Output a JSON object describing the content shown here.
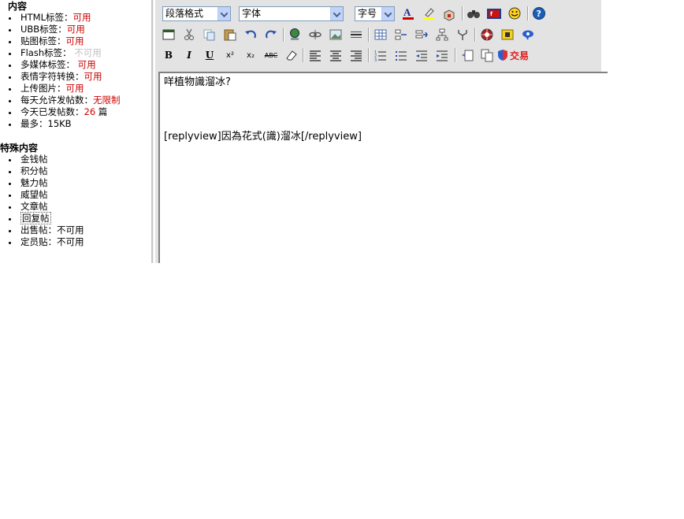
{
  "left": {
    "section1_title": "内容",
    "tags": [
      {
        "label": "HTML标签：",
        "value": "可用",
        "style": "red"
      },
      {
        "label": "UBB标签：",
        "value": "可用",
        "style": "red"
      },
      {
        "label": "贴图标签：",
        "value": "可用",
        "style": "red"
      },
      {
        "label": "Flash标签：",
        "value": "不可用",
        "style": "gray"
      },
      {
        "label": "多媒体标签：",
        "value": "可用",
        "style": "red"
      },
      {
        "label": "表情字符转换：",
        "value": "可用",
        "style": "red"
      },
      {
        "label": "上传图片：",
        "value": "可用",
        "style": "red"
      },
      {
        "label": "每天允许发帖数：",
        "value": "无限制",
        "style": "red"
      },
      {
        "label": "今天已发帖数：",
        "value": "26",
        "suffix": " 篇",
        "style": "red"
      },
      {
        "label": "最多：",
        "value": "15KB",
        "style": "plain"
      }
    ],
    "section2_title": "特殊内容",
    "special": [
      {
        "label": "金钱帖"
      },
      {
        "label": "积分帖"
      },
      {
        "label": "魅力帖"
      },
      {
        "label": "威望帖"
      },
      {
        "label": "文章帖"
      },
      {
        "label": "回复帖"
      },
      {
        "label": "出售帖：不可用"
      },
      {
        "label": "定员贴：不可用"
      }
    ]
  },
  "toolbar": {
    "paragraph_select": "段落格式",
    "font_select": "字体",
    "size_select": "字号",
    "bold_glyph": "B",
    "italic_glyph": "I",
    "underline_glyph": "U",
    "superscript_glyph": "x²",
    "subscript_glyph": "x₂",
    "strike_glyph": "ABC",
    "trade_label": "交易",
    "icons": {
      "font_color": "font-color-icon",
      "highlight": "highlight-icon",
      "box": "box-icon",
      "find": "find-icon",
      "flash": "flash-icon",
      "emoticon": "emoticon-icon",
      "help": "help-icon"
    },
    "colors": {
      "font_color": "#cc0000",
      "highlight": "#ffff00",
      "help": "#1a5fb4"
    }
  },
  "editor": {
    "line1": "咩植物識溜冰?",
    "line2": "[replyview]因為花式(識)溜冰[/replyview]"
  }
}
